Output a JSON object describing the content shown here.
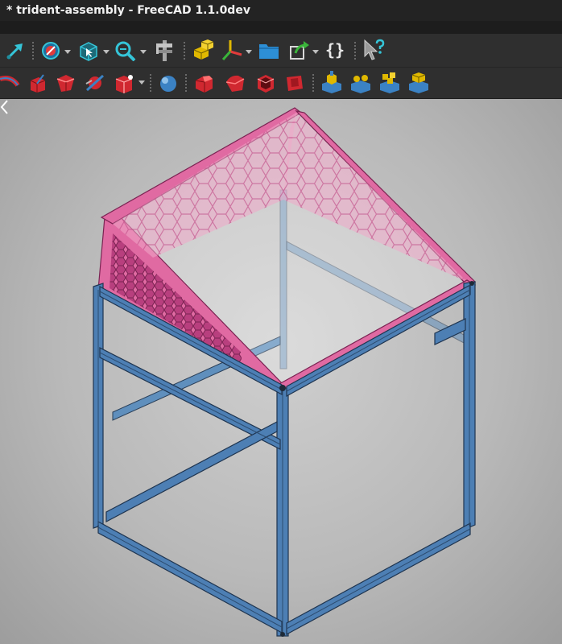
{
  "window": {
    "title": "* trident-assembly - FreeCAD 1.1.0dev"
  },
  "toolbar1": {
    "items": [
      {
        "icon": "macro-arrow-icon"
      },
      {
        "icon": "draw-style-icon"
      },
      {
        "icon": "view-box-icon"
      },
      {
        "icon": "zoom-icon"
      },
      {
        "icon": "measure-caliper-icon"
      },
      {
        "icon": "part-cubes-icon"
      },
      {
        "icon": "axis-cross-icon"
      },
      {
        "icon": "folder-icon"
      },
      {
        "icon": "link-arrow-icon"
      },
      {
        "icon": "braces-icon",
        "label": "{}"
      },
      {
        "icon": "whats-this-icon"
      }
    ]
  },
  "toolbar2": {
    "items": [
      {
        "icon": "revolve-icon"
      },
      {
        "icon": "extrude-icon"
      },
      {
        "icon": "loft-icon"
      },
      {
        "icon": "section-icon"
      },
      {
        "icon": "mirror-box-icon"
      },
      {
        "icon": "sphere-icon"
      },
      {
        "icon": "chamfer-icon"
      },
      {
        "icon": "fillet-icon"
      },
      {
        "icon": "thickness-box-icon"
      },
      {
        "icon": "offset-icon"
      },
      {
        "icon": "boolean-cut-icon"
      },
      {
        "icon": "boolean-fuse-icon"
      },
      {
        "icon": "compound-icon"
      },
      {
        "icon": "stack-icon"
      }
    ]
  },
  "model": {
    "name": "trident-assembly",
    "frame_color": "#4d7fb4",
    "panel_color": "#e06aa2"
  }
}
